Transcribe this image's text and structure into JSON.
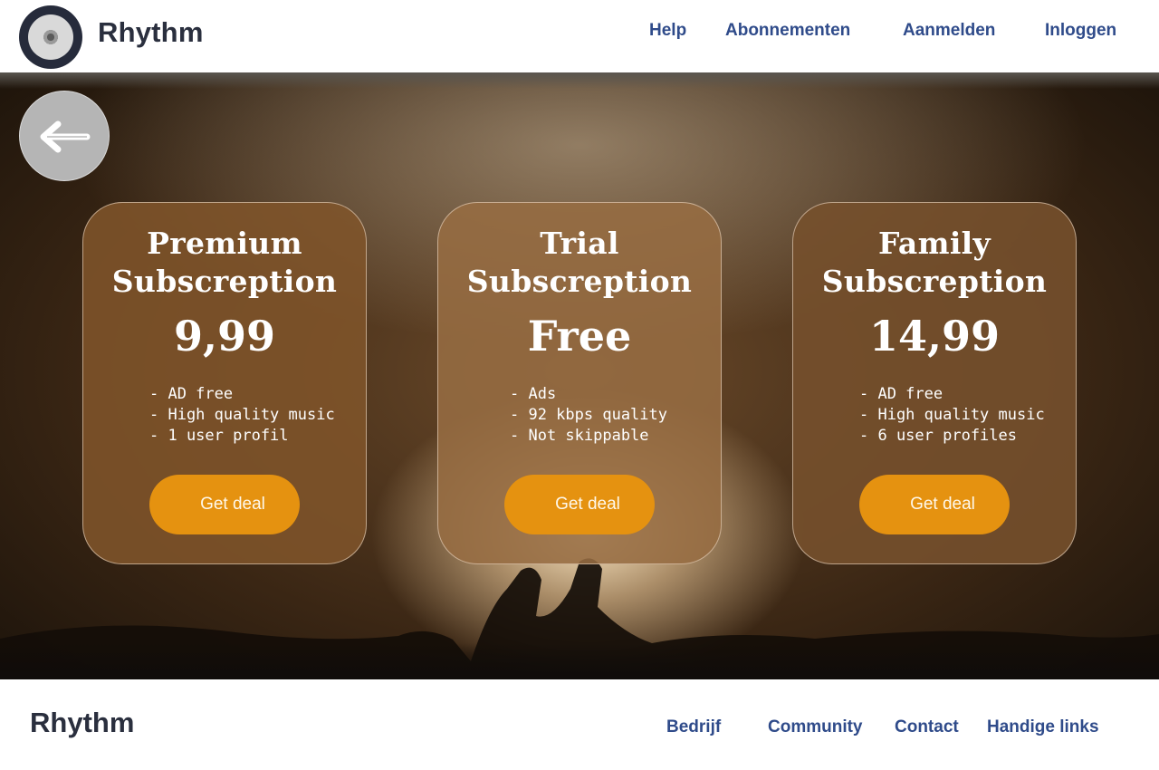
{
  "header": {
    "brand": "Rhythm",
    "nav": {
      "help": "Help",
      "subscriptions": "Abonnementen",
      "register": "Aanmelden",
      "login": "Inloggen"
    }
  },
  "back_button": {
    "icon": "arrow-left-icon"
  },
  "cards": [
    {
      "title_line1": "Premium",
      "title_line2": "Subscreption",
      "price": "9,99",
      "features": [
        "- AD free",
        "- High quality music",
        "- 1 user profil"
      ],
      "button": "Get deal"
    },
    {
      "title_line1": "Trial",
      "title_line2": "Subscreption",
      "price": "Free",
      "features": [
        "- Ads",
        "- 92 kbps quality",
        "- Not skippable"
      ],
      "button": "Get deal"
    },
    {
      "title_line1": "Family",
      "title_line2": "Subscreption",
      "price": "14,99",
      "features": [
        "- AD free",
        "- High quality music",
        "- 6 user profiles"
      ],
      "button": "Get deal"
    }
  ],
  "footer": {
    "brand": "Rhythm",
    "links": {
      "company": "Bedrijf",
      "community": "Community",
      "contact": "Contact",
      "handy_links": "Handige links"
    }
  },
  "colors": {
    "accent": "#e59210",
    "nav_text": "#2f4b8a",
    "brand_text": "#2a2f3e"
  }
}
